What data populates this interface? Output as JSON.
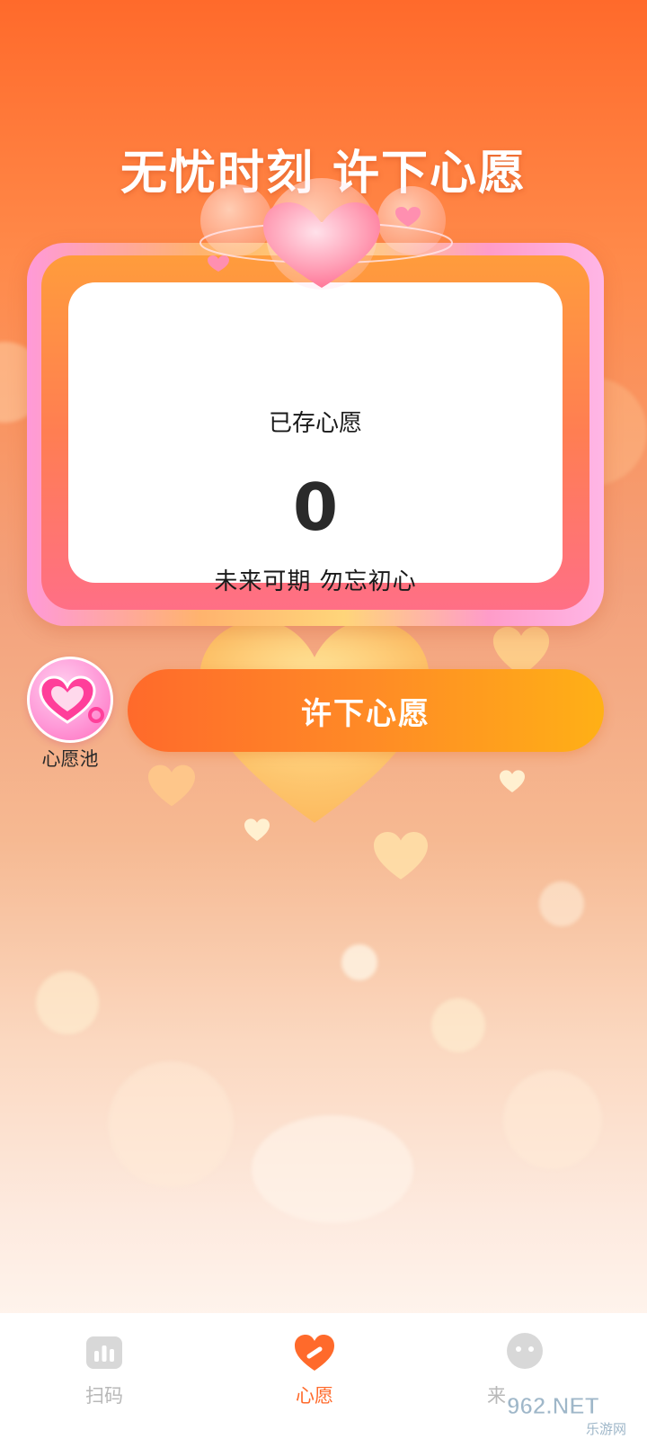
{
  "headline": "无忧时刻 许下心愿",
  "wish_card": {
    "label": "已存心愿",
    "count": "0",
    "motto": "未来可期  勿忘初心"
  },
  "pool_button": {
    "label": "心愿池",
    "icon": "heart-pool-icon"
  },
  "wish_button": {
    "label": "许下心愿"
  },
  "tabs": [
    {
      "label": "扫码",
      "icon": "scan-chart-icon",
      "active": false
    },
    {
      "label": "心愿",
      "icon": "heart-icon",
      "active": true
    },
    {
      "label": "来",
      "icon": "smiley-icon",
      "active": false
    }
  ],
  "watermark": {
    "brand": "962.NET",
    "subtitle": "乐游网"
  },
  "colors": {
    "accent": "#ff6a2b",
    "button_end": "#ffb016",
    "inactive_tab": "#b8b8b8"
  }
}
